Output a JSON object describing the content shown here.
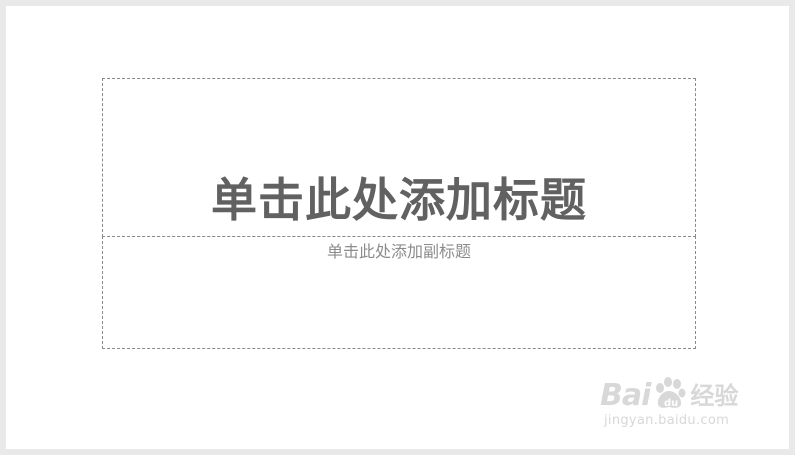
{
  "slide": {
    "title_placeholder": "单击此处添加标题",
    "subtitle_placeholder": "单击此处添加副标题"
  },
  "watermark": {
    "brand_left": "Bai",
    "brand_right": "du",
    "product": "经验",
    "url": "jingyan.baidu.com",
    "icon": "baidu-paw-icon"
  },
  "colors": {
    "title": "#616161",
    "subtitle": "#8c8c8c",
    "placeholder_border": "#8a8a8a",
    "watermark": "#d8d8d8",
    "frame": "#e9e9e9"
  }
}
